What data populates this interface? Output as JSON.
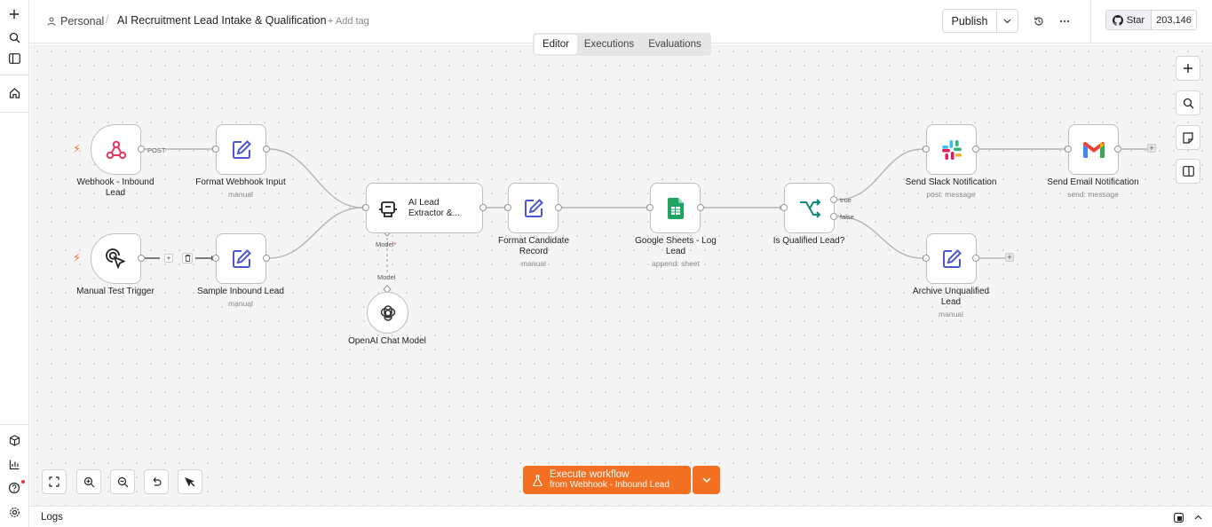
{
  "header": {
    "project": "Personal",
    "workflow_title": "AI Recruitment Lead Intake & Qualification",
    "add_tag": "+ Add tag",
    "publish_label": "Publish",
    "star_label": "Star",
    "star_count": "203,146"
  },
  "tabs": [
    {
      "label": "Editor",
      "active": true
    },
    {
      "label": "Executions",
      "active": false
    },
    {
      "label": "Evaluations",
      "active": false
    }
  ],
  "nodes": {
    "webhook": {
      "label": "Webhook - Inbound Lead",
      "icon": "webhook-icon",
      "color": "#e8375f"
    },
    "manual_trigger": {
      "label": "Manual Test Trigger",
      "icon": "pointer-click-icon",
      "color": "#222222"
    },
    "format_webhook": {
      "label": "Format Webhook Input",
      "sub": "manual",
      "icon": "pencil-square-icon",
      "color": "#4b56d6"
    },
    "sample_lead": {
      "label": "Sample Inbound Lead",
      "sub": "manual",
      "icon": "pencil-square-icon",
      "color": "#4b56d6"
    },
    "ai_extractor": {
      "label": "AI Lead Extractor &...",
      "icon": "robot-icon",
      "color": "#222222"
    },
    "openai": {
      "label": "OpenAI Chat Model",
      "icon": "openai-icon"
    },
    "format_candidate": {
      "label": "Format Candidate Record",
      "sub": "manual",
      "icon": "pencil-square-icon",
      "color": "#4b56d6"
    },
    "sheets": {
      "label": "Google Sheets - Log Lead",
      "sub": "append: sheet",
      "icon": "google-sheets-icon",
      "color": "#1fa463"
    },
    "if_qualified": {
      "label": "Is Qualified Lead?",
      "icon": "branch-icon",
      "color": "#0f8a78"
    },
    "slack": {
      "label": "Send Slack Notification",
      "sub": "post: message",
      "icon": "slack-icon"
    },
    "email": {
      "label": "Send Email Notification",
      "sub": "send: message",
      "icon": "gmail-icon"
    },
    "archive": {
      "label": "Archive Unqualified Lead",
      "sub": "manual",
      "icon": "pencil-square-icon",
      "color": "#4b56d6"
    }
  },
  "edge_labels": {
    "post": "POST",
    "model_port": "Model",
    "model_required": "*",
    "model_edge": "Model",
    "true": "true",
    "false": "false"
  },
  "execute": {
    "line1": "Execute workflow",
    "line2": "from Webhook - Inbound Lead"
  },
  "logs_label": "Logs",
  "colors": {
    "accent": "#f36f21",
    "node_border": "#bfbfbf"
  }
}
